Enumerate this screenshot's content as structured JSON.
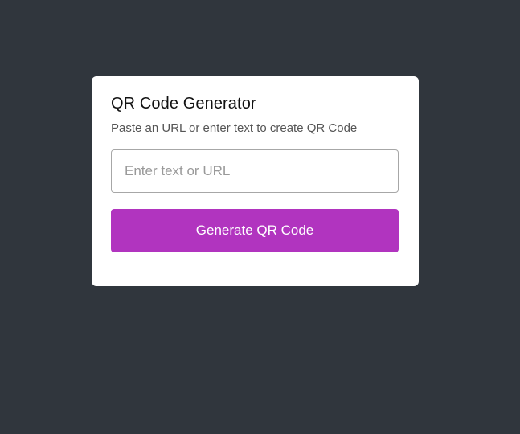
{
  "card": {
    "title": "QR Code Generator",
    "subtitle": "Paste an URL or enter text to create QR Code",
    "input": {
      "value": "",
      "placeholder": "Enter text or URL"
    },
    "button_label": "Generate QR Code"
  },
  "colors": {
    "background": "#30363d",
    "card": "#ffffff",
    "button": "#b134bf",
    "input_border": "#a7a7a7"
  }
}
